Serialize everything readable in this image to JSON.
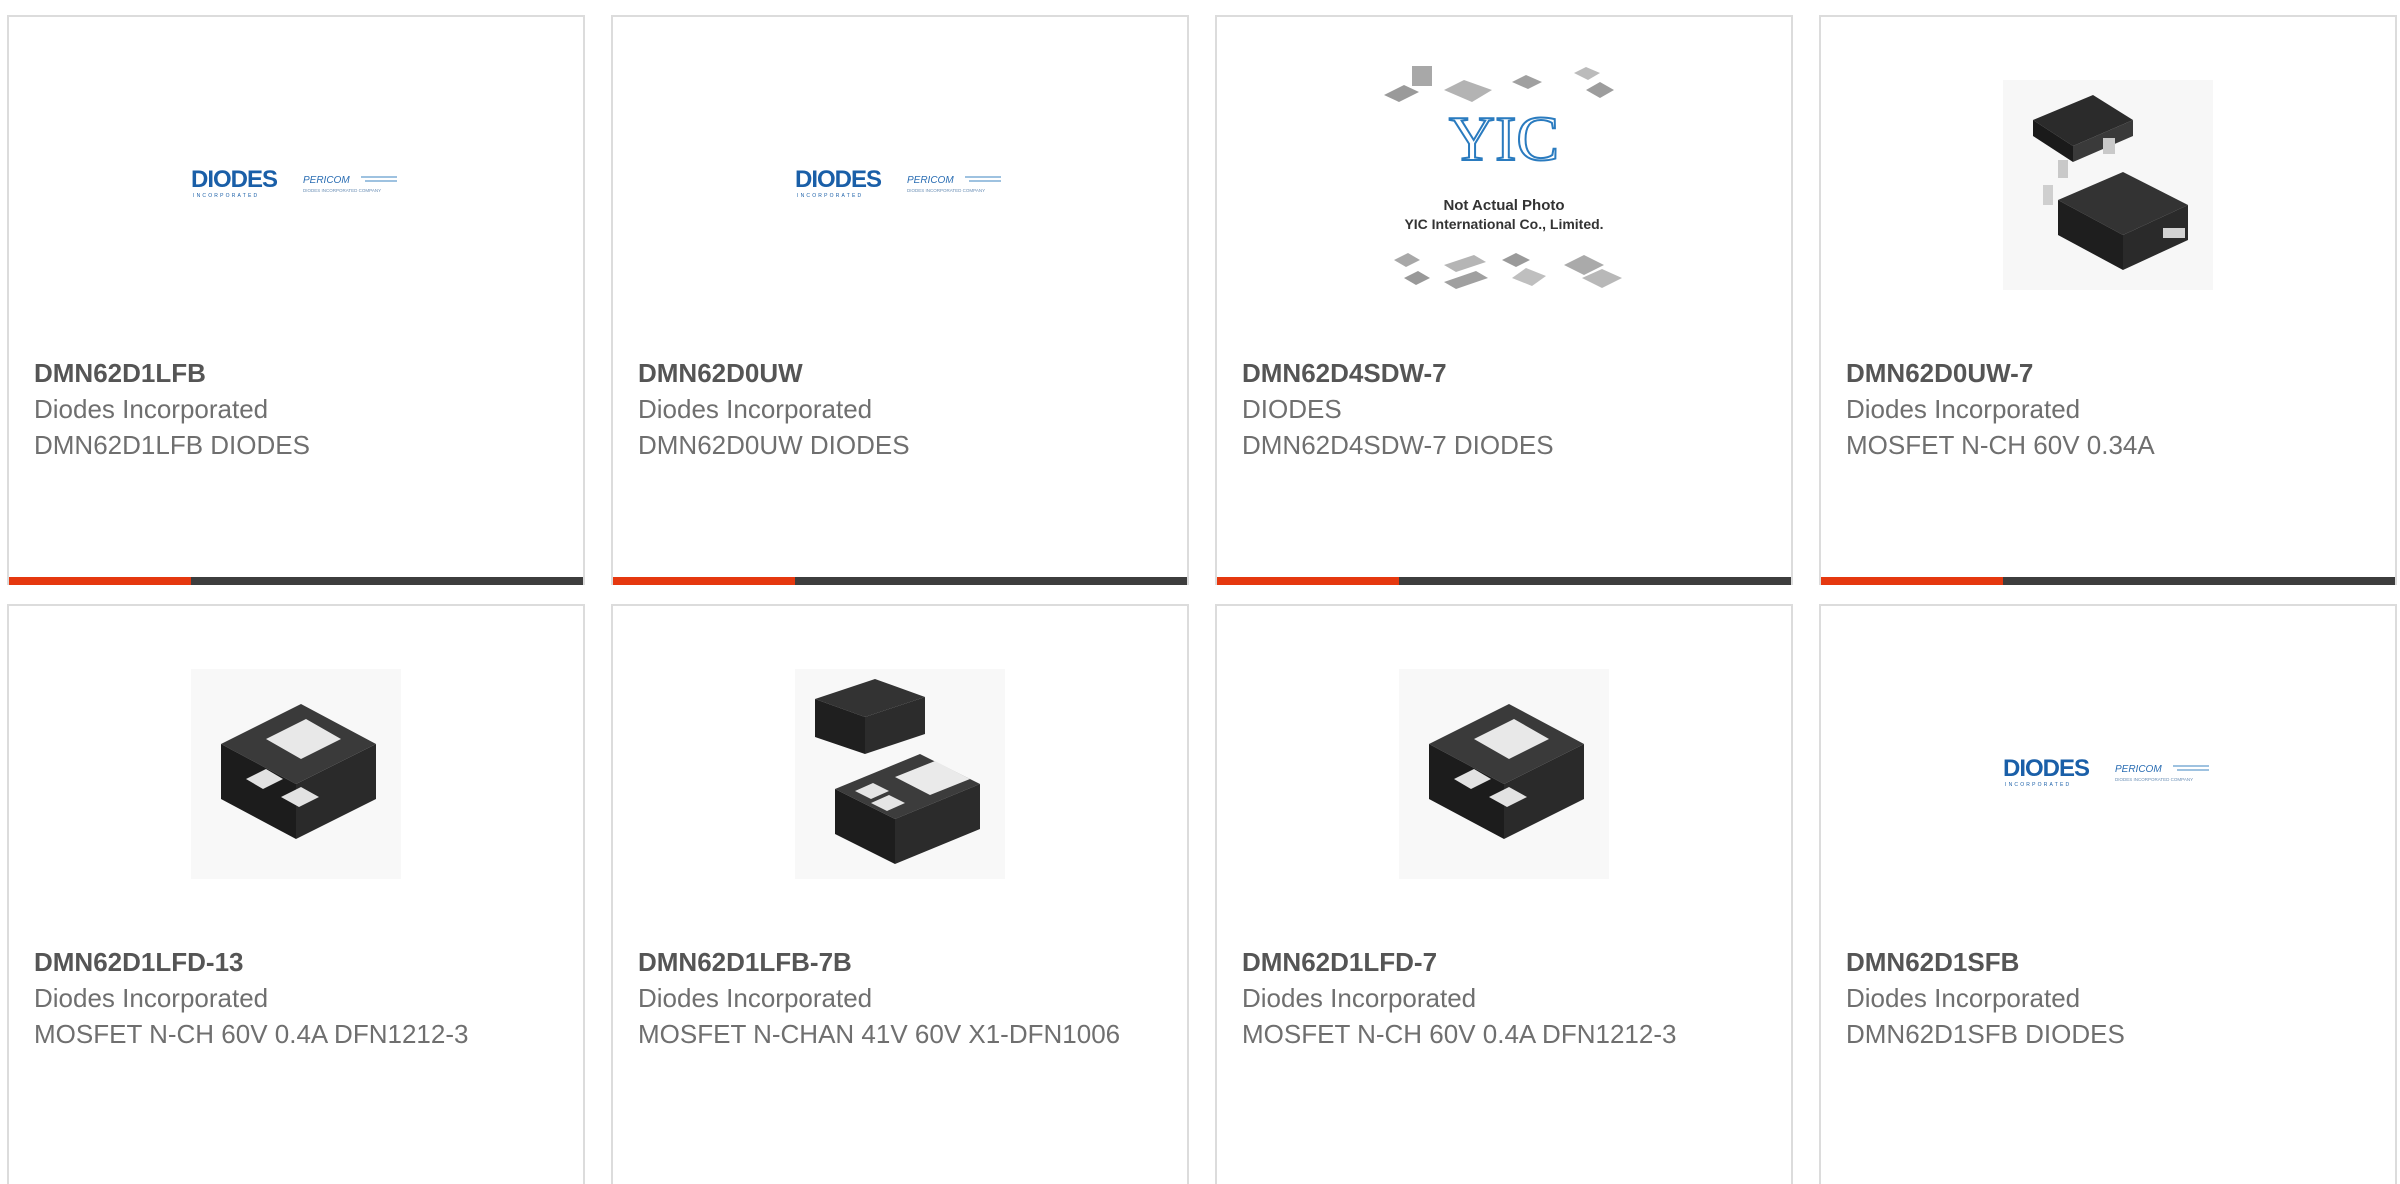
{
  "colors": {
    "accent": "#e5380f",
    "bar_dark": "#3d3d3d",
    "card_border": "#dcdcdc",
    "diodes_blue": "#1a5fa8"
  },
  "diodes_logo": {
    "brand": "DIODES",
    "sub": "INCORPORATED",
    "pericom": "PERICOM",
    "pericom_tag": "DIODES INCORPORATED COMPANY"
  },
  "placeholder": {
    "logo": "YIC",
    "line1": "Not Actual Photo",
    "line2": "YIC International Co., Limited."
  },
  "products": [
    {
      "image": "diodes-logo",
      "part_number": "DMN62D1LFB",
      "manufacturer": "Diodes Incorporated",
      "description": "DMN62D1LFB DIODES"
    },
    {
      "image": "diodes-logo",
      "part_number": "DMN62D0UW",
      "manufacturer": "Diodes Incorporated",
      "description": "DMN62D0UW DIODES"
    },
    {
      "image": "not-actual-photo",
      "part_number": "DMN62D4SDW-7",
      "manufacturer": "DIODES",
      "description": "DMN62D4SDW-7 DIODES"
    },
    {
      "image": "sot323-package",
      "part_number": "DMN62D0UW-7",
      "manufacturer": "Diodes Incorporated",
      "description": "MOSFET N-CH 60V 0.34A"
    },
    {
      "image": "dfn1212-package",
      "part_number": "DMN62D1LFD-13",
      "manufacturer": "Diodes Incorporated",
      "description": "MOSFET N-CH 60V 0.4A DFN1212-3"
    },
    {
      "image": "dfn1006-package",
      "part_number": "DMN62D1LFB-7B",
      "manufacturer": "Diodes Incorporated",
      "description": "MOSFET N-CHAN 41V 60V X1-DFN1006"
    },
    {
      "image": "dfn1212-package",
      "part_number": "DMN62D1LFD-7",
      "manufacturer": "Diodes Incorporated",
      "description": "MOSFET N-CH 60V 0.4A DFN1212-3"
    },
    {
      "image": "diodes-logo",
      "part_number": "DMN62D1SFB",
      "manufacturer": "Diodes Incorporated",
      "description": "DMN62D1SFB DIODES"
    }
  ]
}
